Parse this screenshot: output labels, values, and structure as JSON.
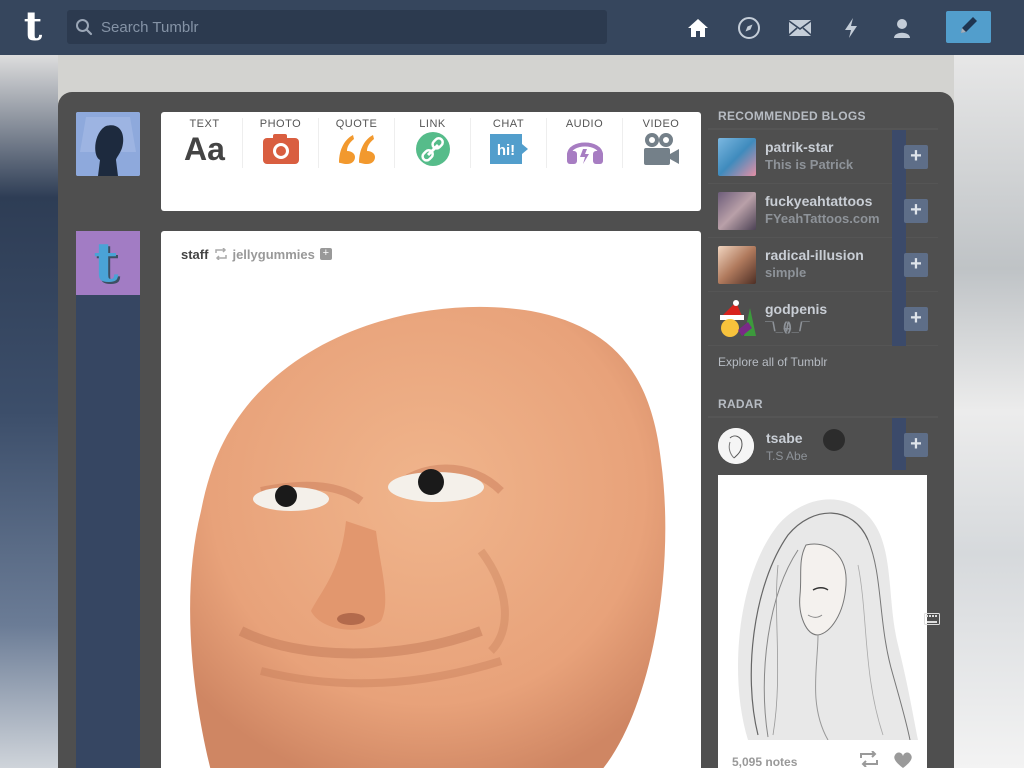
{
  "header": {
    "logo": "t",
    "search_placeholder": "Search Tumblr",
    "icons": [
      "home-icon",
      "explore-icon",
      "inbox-icon",
      "activity-icon",
      "account-icon"
    ],
    "compose_icon": "pencil-icon",
    "colors": {
      "bar": "#36465d",
      "compose": "#529ecc"
    }
  },
  "post_types": [
    {
      "label": "TEXT",
      "glyph": "Aa",
      "color": "#444444"
    },
    {
      "label": "PHOTO",
      "glyph": "photo",
      "color": "#d95e40"
    },
    {
      "label": "QUOTE",
      "glyph": "“",
      "color": "#f2992e"
    },
    {
      "label": "LINK",
      "glyph": "link",
      "color": "#56bc8a"
    },
    {
      "label": "CHAT",
      "glyph": "hi!",
      "color": "#529ecc"
    },
    {
      "label": "AUDIO",
      "glyph": "audio",
      "color": "#a77dc2"
    },
    {
      "label": "VIDEO",
      "glyph": "video",
      "color": "#748089"
    }
  ],
  "post": {
    "author": "staff",
    "reblogged_from": "jellygummies"
  },
  "sidebar": {
    "recommended_title": "RECOMMENDED BLOGS",
    "blogs": [
      {
        "name": "patrik-star",
        "title": "This is Patrick",
        "thumb_color": "#6aa9d3"
      },
      {
        "name": "fuckyeahtattoos",
        "title": "FYeahTattoos.com",
        "thumb_color": "#8c7b9a"
      },
      {
        "name": "radical-illusion",
        "title": "simple",
        "thumb_color": "#c89a7d"
      },
      {
        "name": "godpenis",
        "title": "¯\\_(̸̶̸̸̸̸̸̸̸̶̸)_/¯",
        "thumb_color": "#ffffff"
      }
    ],
    "explore_label": "Explore all of Tumblr",
    "radar_title": "RADAR",
    "radar": {
      "name": "tsabe",
      "title": "T.S Abe",
      "notes": "5,095 notes"
    }
  }
}
